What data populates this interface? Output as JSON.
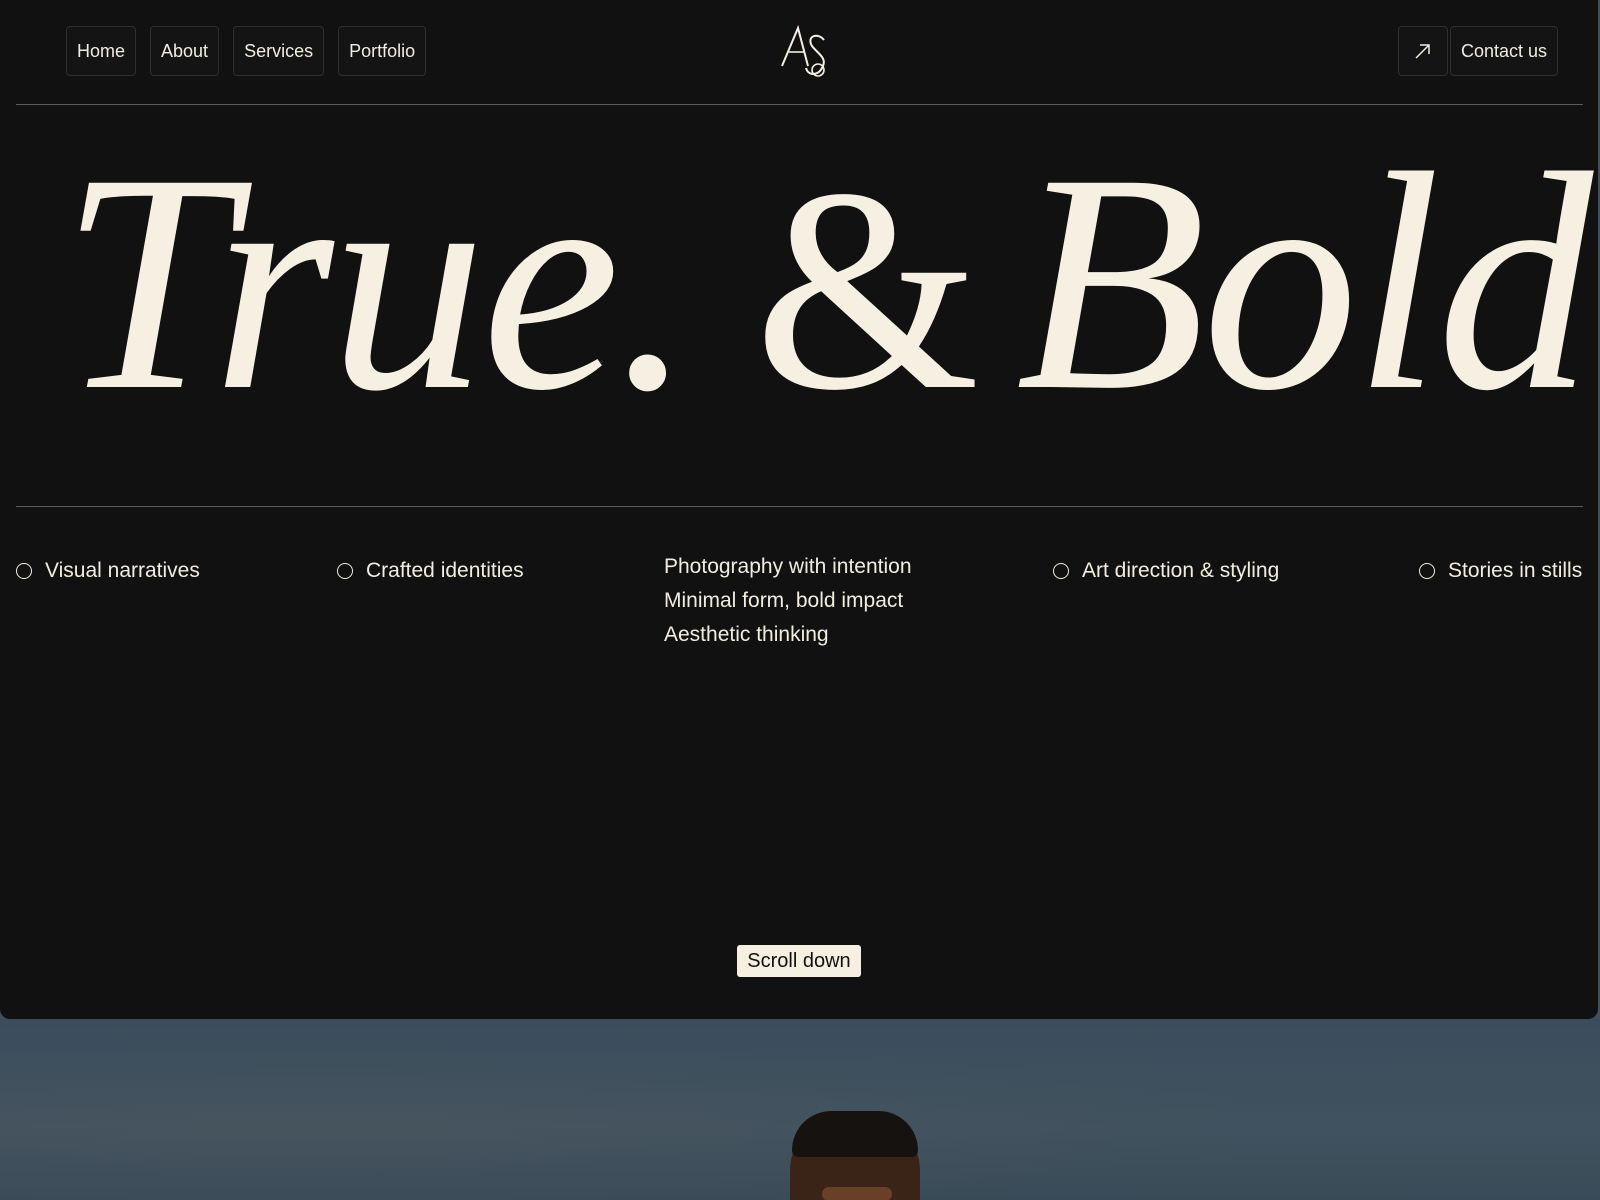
{
  "nav": {
    "links": [
      {
        "label": "Home"
      },
      {
        "label": "About"
      },
      {
        "label": "Services"
      },
      {
        "label": "Portfolio"
      }
    ],
    "logo_text": "AS",
    "contact_label": "Contact us",
    "arrow_icon": "arrow-up-right-icon"
  },
  "hero": {
    "headline_word1": "True.",
    "headline_amp": "&",
    "headline_word2": "Bold.",
    "taglines": {
      "t1": "Visual narratives",
      "t2": "Crafted identities",
      "stack": [
        "Photography with intention",
        "Minimal form, bold impact",
        "Aesthetic thinking"
      ],
      "t4": "Art direction & styling",
      "t5": "Stories in stills"
    },
    "scroll_label": "Scroll down"
  },
  "colors": {
    "background": "#111111",
    "text": "#f5f0e1",
    "photo_sky": "#3f4f5c"
  }
}
